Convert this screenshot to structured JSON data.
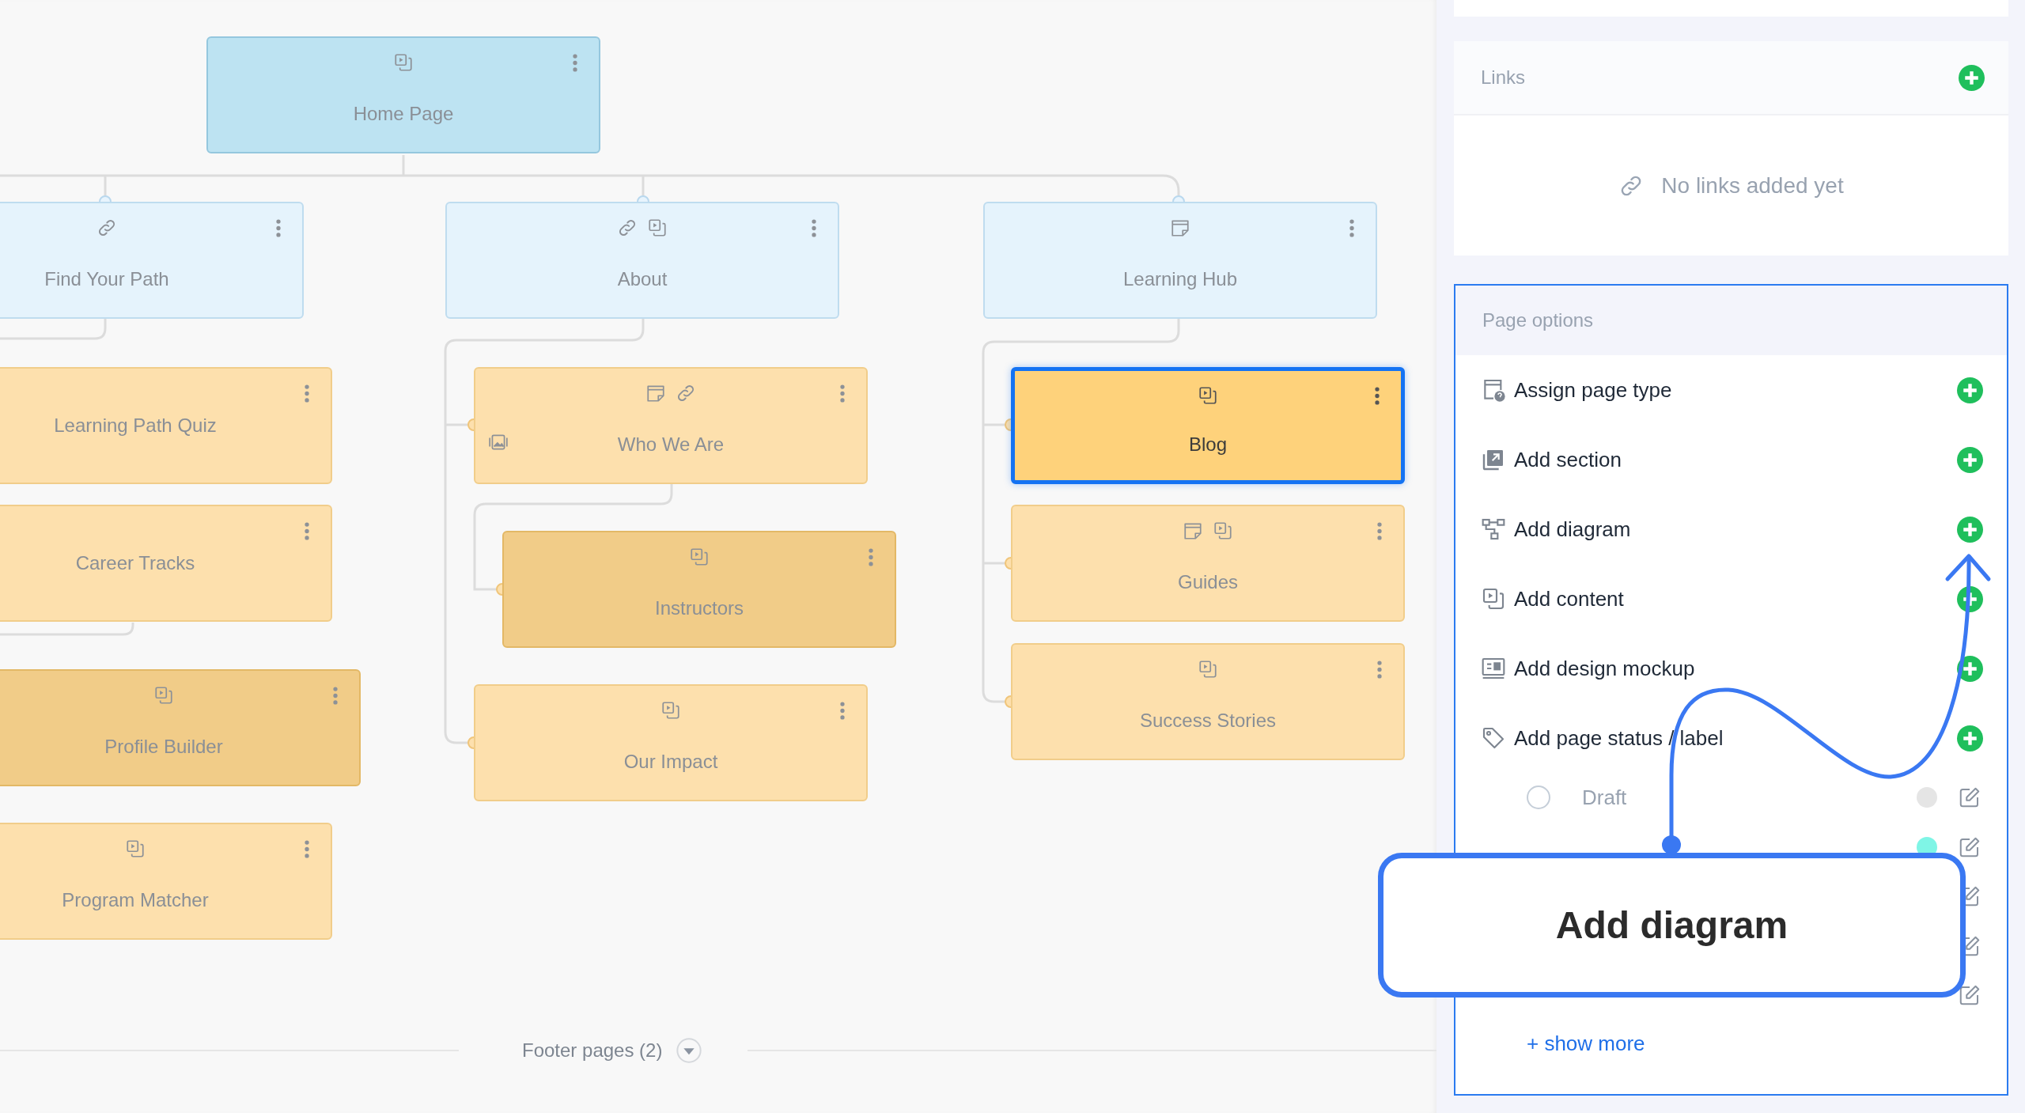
{
  "diagram": {
    "nodes": [
      {
        "title": "Home Page",
        "kind": "home",
        "selected": false,
        "icons": [
          {
            "kind": "content"
          }
        ]
      },
      {
        "title": "Find Your Path",
        "kind": "page",
        "selected": false,
        "icons": [
          {
            "kind": "link"
          }
        ]
      },
      {
        "title": "About",
        "kind": "page",
        "selected": false,
        "icons": [
          {
            "kind": "link"
          },
          {
            "kind": "content"
          }
        ]
      },
      {
        "title": "Learning Hub",
        "kind": "page",
        "selected": false,
        "icons": [
          {
            "kind": "note"
          }
        ]
      },
      {
        "title": "Learning Path Quiz",
        "kind": "content",
        "selected": false,
        "highlighted": false
      },
      {
        "title": "Who We Are",
        "kind": "content",
        "selected": false,
        "highlighted": false,
        "icons": [
          {
            "kind": "note"
          },
          {
            "kind": "link"
          }
        ],
        "side_icon": {
          "kind": "mockup"
        }
      },
      {
        "title": "Blog",
        "kind": "content",
        "selected": true,
        "highlighted": false,
        "icons": [
          {
            "kind": "content"
          }
        ]
      },
      {
        "title": "Career Tracks",
        "kind": "content",
        "selected": false,
        "highlighted": false
      },
      {
        "title": "Guides",
        "kind": "content",
        "selected": false,
        "highlighted": false,
        "icons": [
          {
            "kind": "note"
          },
          {
            "kind": "content"
          }
        ]
      },
      {
        "title": "Instructors",
        "kind": "content",
        "selected": false,
        "highlighted": true,
        "icons": [
          {
            "kind": "content"
          }
        ]
      },
      {
        "title": "Success Stories",
        "kind": "content",
        "selected": false,
        "highlighted": false,
        "icons": [
          {
            "kind": "content"
          }
        ]
      },
      {
        "title": "Profile Builder",
        "kind": "content",
        "selected": false,
        "highlighted": true,
        "icons": [
          {
            "kind": "content"
          }
        ]
      },
      {
        "title": "Our Impact",
        "kind": "content",
        "selected": false,
        "highlighted": false,
        "icons": [
          {
            "kind": "content"
          }
        ]
      },
      {
        "title": "Program Matcher",
        "kind": "content",
        "selected": false,
        "highlighted": false,
        "icons": [
          {
            "kind": "content"
          }
        ]
      }
    ],
    "footer": {
      "label": "Footer pages (2)"
    }
  },
  "panel": {
    "links": {
      "title": "Links",
      "empty_text": "No links added yet"
    },
    "page_options": {
      "title": "Page options",
      "actions": [
        {
          "kind": "type",
          "label": "Assign page type"
        },
        {
          "kind": "section",
          "label": "Add section"
        },
        {
          "kind": "diagram",
          "label": "Add diagram"
        },
        {
          "kind": "content",
          "label": "Add content"
        },
        {
          "kind": "mockup",
          "label": "Add design mockup"
        },
        {
          "kind": "label",
          "label": "Add page status / label"
        }
      ],
      "statuses": [
        {
          "kind": "shown",
          "label": "Draft",
          "selected": false,
          "color": "#e5e5e5"
        },
        {
          "kind": "covered",
          "color": "#7ff5e6"
        },
        {
          "kind": "covered"
        },
        {
          "kind": "covered"
        },
        {
          "kind": "covered"
        }
      ],
      "show_more": "+ show more"
    }
  },
  "callout": {
    "text": "Add diagram"
  }
}
